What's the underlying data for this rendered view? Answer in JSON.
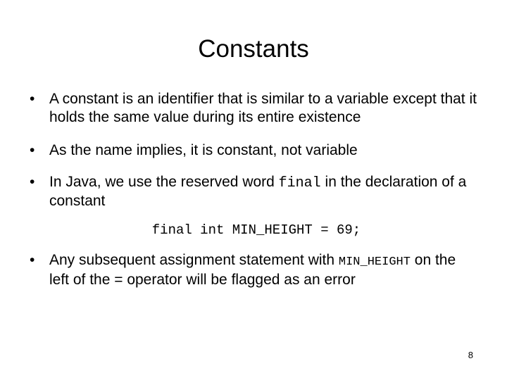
{
  "slide": {
    "title": "Constants",
    "background_color": "#ffffff",
    "text_color": "#000000",
    "page_number": "8",
    "bullet_marker": "•"
  },
  "bullets": [
    {
      "id": "bullet-constant-definition",
      "marker": "•",
      "text": "A constant is an identifier that is similar to a variable except that it holds the same value during its entire existence"
    },
    {
      "id": "bullet-name-implies",
      "marker": "•",
      "text": "As the name implies, it is constant, not variable"
    },
    {
      "id": "bullet-java-final",
      "marker": "•",
      "lead": "In Java, we use the reserved word ",
      "code": "final",
      "trail": " in the declaration of a constant"
    },
    {
      "id": "bullet-reassignment-error",
      "marker": "•",
      "lead": "Any subsequent assignment statement with ",
      "code": "MIN_HEIGHT",
      "trail": " on the left of the = operator will be flagged as an error"
    }
  ],
  "code_example": {
    "statement": "final int MIN_HEIGHT = 69;"
  }
}
